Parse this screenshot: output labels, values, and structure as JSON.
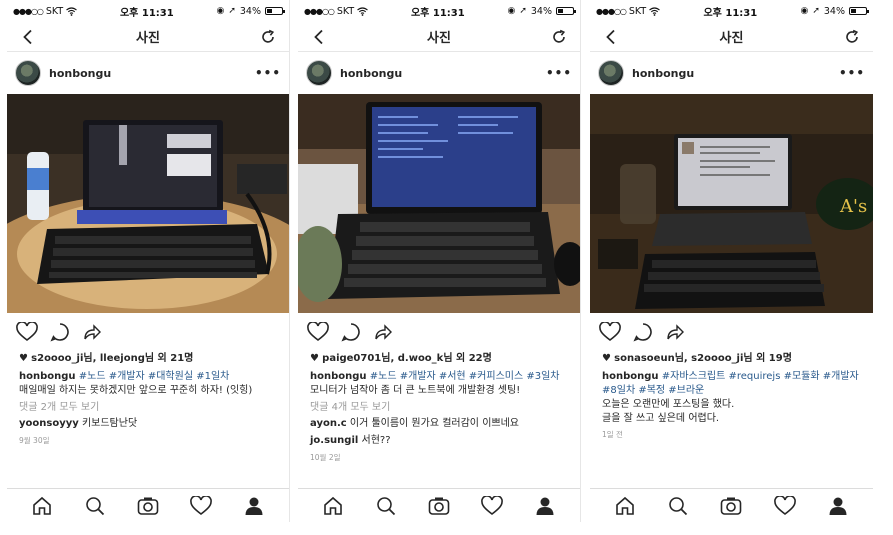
{
  "status_bar": {
    "carrier": "SKT",
    "time": "오후 11:31",
    "battery": "34%",
    "battery_fill": 0.34
  },
  "nav": {
    "title": "사진"
  },
  "posts": [
    {
      "username": "honbongu",
      "likes_prefix": "s2oooo_ji님, lleejong님 외 ",
      "likes_count": "21명",
      "caption_user": "honbongu",
      "hashtags": "#노드 #개발자 #대학원실 #1일차",
      "caption_text": "매일매일 하지는 못하겠지만 앞으로 꾸준히 하자! (잇힝)",
      "view_all": "댓글 2개 모두 보기",
      "comments": [
        {
          "user": "yoonsoyyy",
          "text": "키보드탐난닷"
        }
      ],
      "time": "9월 30일",
      "photo_colors": {
        "bg": "#3a2f22",
        "table": "#c9a36a",
        "screen": "#1b1b22"
      }
    },
    {
      "username": "honbongu",
      "likes_prefix": "paige0701님, d.woo_k님 외 ",
      "likes_count": "22명",
      "caption_user": "honbongu",
      "hashtags": "#노드 #개발자 #서현 #커피스미스 #3일차",
      "caption_text": "모니터가 넘작아 좀 더 큰 노트북에 개발환경 셋팅!",
      "view_all": "댓글 4개 모두 보기",
      "comments": [
        {
          "user": "ayon.c",
          "text": "이거 툴이름이 뭔가요 컬러감이 이쁘네요"
        },
        {
          "user": "jo.sungil",
          "text": "서현??"
        }
      ],
      "time": "10월 2일",
      "photo_colors": {
        "bg": "#5a4330",
        "table": "#8a6a48",
        "screen": "#2b3f8a"
      }
    },
    {
      "username": "honbongu",
      "likes_prefix": "sonasoeun님, s2oooo_ji님 외 ",
      "likes_count": "19명",
      "caption_user": "honbongu",
      "hashtags": "#자바스크립트 #requirejs #모듈화 #개발자 #8일차 #복정 #브라운",
      "caption_lines": [
        "오늘은 오랜만에 포스팅을 했다.",
        "글을 잘 쓰고 싶은데 어렵다."
      ],
      "time": "1일 전",
      "photo_colors": {
        "bg": "#2a2015",
        "table": "#3a2c1c",
        "screen": "#c9c9cf"
      }
    }
  ],
  "photo_labels": {
    "sticker": "A's"
  },
  "icons": [
    "back-icon",
    "refresh-icon",
    "more-icon",
    "heart-icon",
    "comment-icon",
    "share-icon",
    "home-icon",
    "search-icon",
    "camera-icon",
    "activity-icon",
    "profile-icon"
  ]
}
